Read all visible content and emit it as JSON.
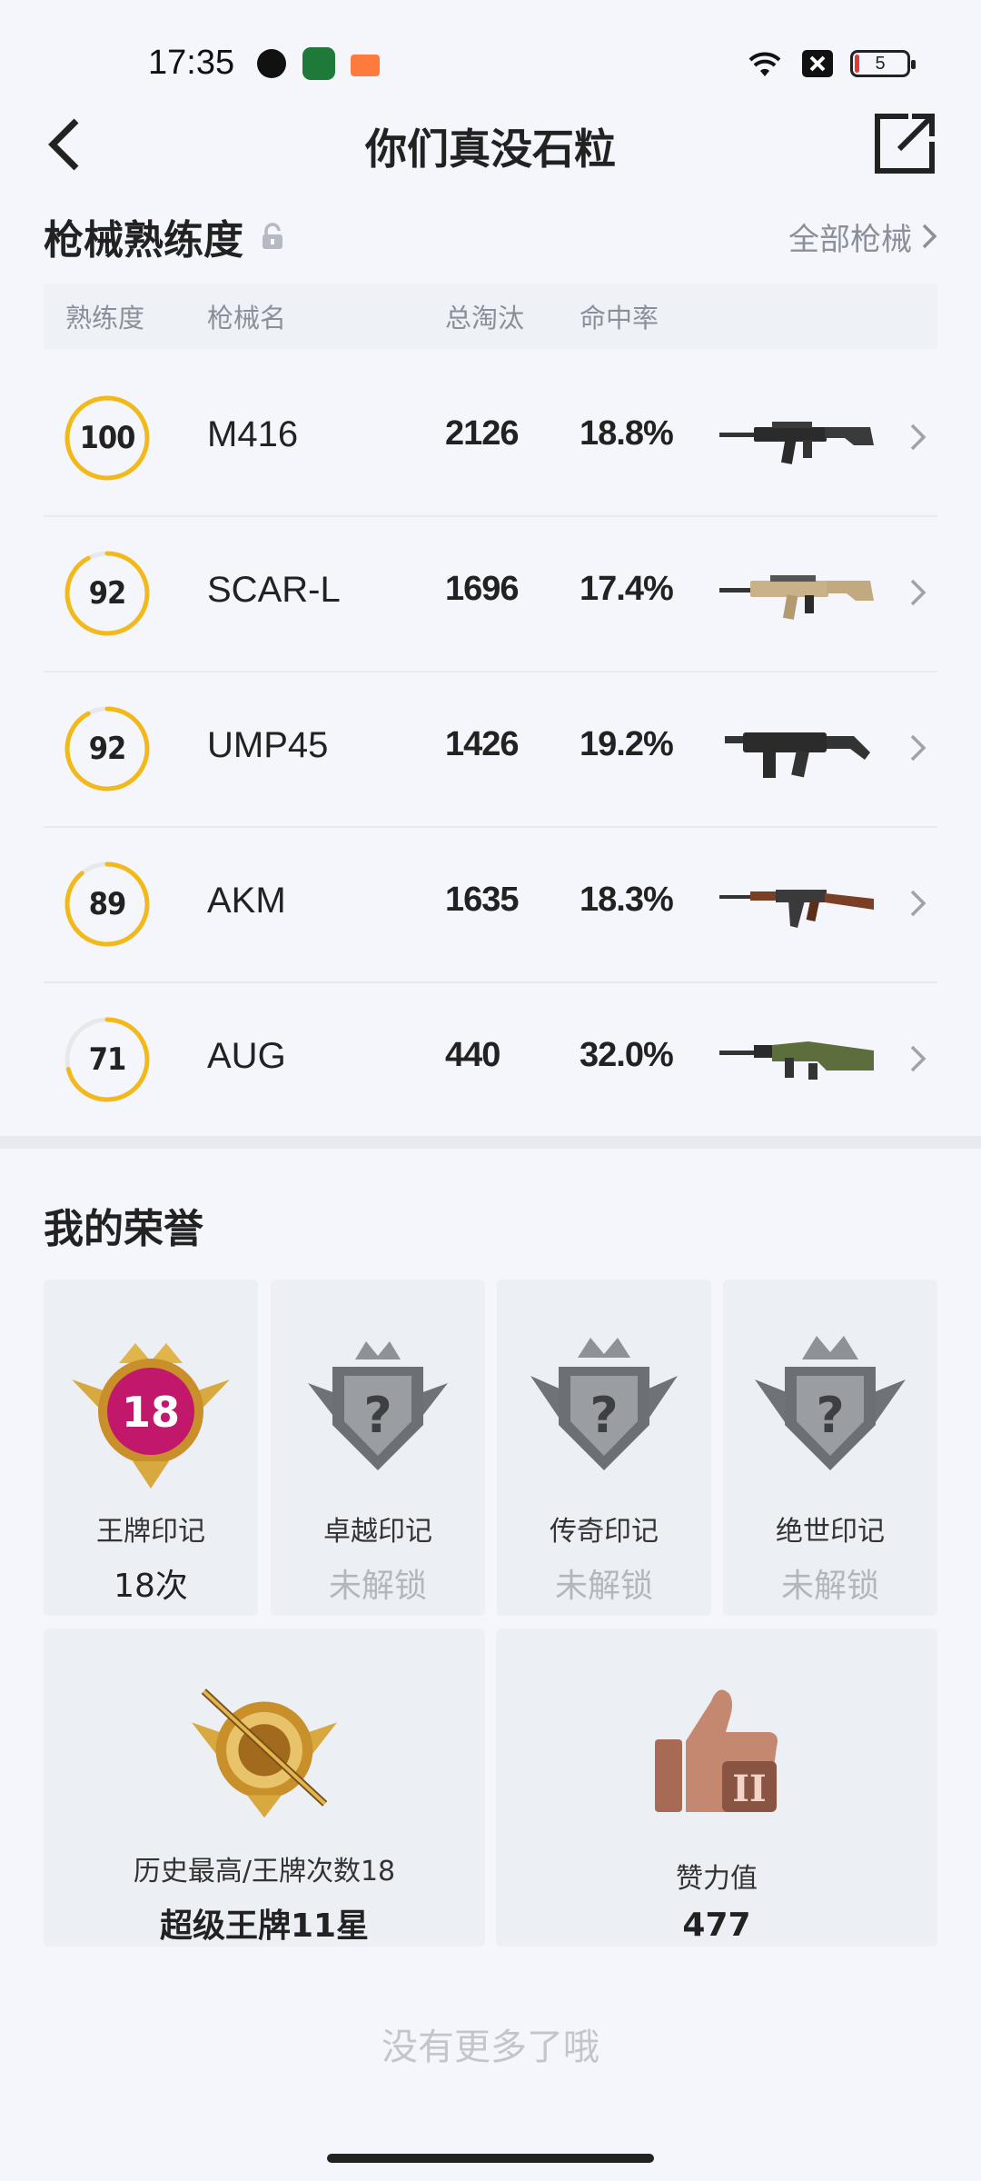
{
  "status": {
    "time": "17:35",
    "battery": "5"
  },
  "header": {
    "title": "你们真没石粒"
  },
  "weapons": {
    "title": "枪械熟练度",
    "all_link": "全部枪械",
    "columns": {
      "proficiency": "熟练度",
      "name": "枪械名",
      "kills": "总淘汰",
      "accuracy": "命中率"
    },
    "rows": [
      {
        "proficiency": "100",
        "name": "M416",
        "kills": "2126",
        "accuracy": "18.8%",
        "ring_fill": 1.0
      },
      {
        "proficiency": "92",
        "name": "SCAR-L",
        "kills": "1696",
        "accuracy": "17.4%",
        "ring_fill": 0.92
      },
      {
        "proficiency": "92",
        "name": "UMP45",
        "kills": "1426",
        "accuracy": "19.2%",
        "ring_fill": 0.92
      },
      {
        "proficiency": "89",
        "name": "AKM",
        "kills": "1635",
        "accuracy": "18.3%",
        "ring_fill": 0.89
      },
      {
        "proficiency": "71",
        "name": "AUG",
        "kills": "440",
        "accuracy": "32.0%",
        "ring_fill": 0.71
      }
    ]
  },
  "honors": {
    "title": "我的荣誉",
    "marks": [
      {
        "label": "王牌印记",
        "value": "18次",
        "badge_number": "18"
      },
      {
        "label": "卓越印记",
        "value": "未解锁"
      },
      {
        "label": "传奇印记",
        "value": "未解锁"
      },
      {
        "label": "绝世印记",
        "value": "未解锁"
      }
    ],
    "best": {
      "label": "历史最高/王牌次数18",
      "value": "超级王牌11星"
    },
    "likes": {
      "label": "赞力值",
      "value": "477"
    }
  },
  "footer": {
    "note": "没有更多了哦"
  },
  "colors": {
    "accent": "#f3b91b",
    "muted": "#8a8f99",
    "background": "#f4f6fb"
  }
}
